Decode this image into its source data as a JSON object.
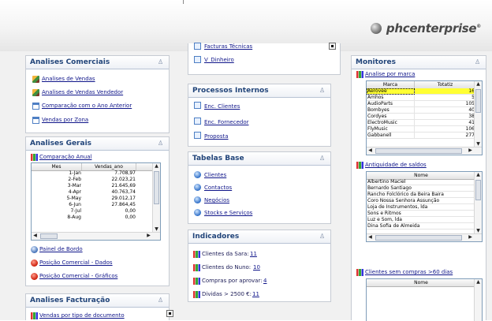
{
  "header": {
    "logo_text": "phcenterprise",
    "logo_mark": "®"
  },
  "col1": {
    "comerciais": {
      "title": "Analises Comerciais",
      "links": [
        "Analises de Vendas",
        "Analises de Vendas Vendedor",
        "Comparação com o Ano Anterior",
        "Vendas por Zona"
      ]
    },
    "gerais": {
      "title": "Analises Gerais",
      "table_link": "Comparação Anual",
      "cols": [
        "Mes",
        "Vendas_ano"
      ],
      "rows": [
        [
          "1-Jan",
          "7.708,97"
        ],
        [
          "2-Feb",
          "22.023,21"
        ],
        [
          "3-Mar",
          "21.645,69"
        ],
        [
          "4-Apr",
          "40.763,74"
        ],
        [
          "5-May",
          "29.012,17"
        ],
        [
          "6-Jun",
          "27.864,45"
        ],
        [
          "7-Jul",
          "0,00"
        ],
        [
          "8-Aug",
          "0,00"
        ]
      ],
      "links": [
        "Painel de Bordo",
        "Posição Comercial - Dados",
        "Posição Comercial - Gráficos"
      ]
    },
    "facturacao": {
      "title": "Analises Facturação",
      "links": [
        "Vendas por tipo de documento"
      ]
    }
  },
  "col2": {
    "top_links": [
      "Facturas Técnicas",
      "V_Dinheiro"
    ],
    "processos": {
      "title": "Processos Internos",
      "links": [
        "Enc. Clientes",
        "Enc. Fornecedor",
        "Proposta"
      ]
    },
    "tabelas": {
      "title": "Tabelas Base",
      "links": [
        "Clientes",
        "Contactos",
        "Negócios",
        "Stocks e Serviços"
      ]
    },
    "indicadores": {
      "title": "Indicadores",
      "items": [
        {
          "label": "Clientes da Sara:",
          "value": "11"
        },
        {
          "label": "Clientes do Nuno:",
          "value": "10"
        },
        {
          "label": "Compras por aprovar:",
          "value": "4"
        },
        {
          "label": "Dividas > 2500 €:",
          "value": "11"
        }
      ]
    }
  },
  "col3": {
    "title": "Monitores",
    "marca": {
      "link": "Analise por marca",
      "cols": [
        "Marca",
        "Totatiz"
      ],
      "rows": [
        [
          "Aerovee",
          "16"
        ],
        [
          "Amhos",
          "5"
        ],
        [
          "AudioParts",
          "105"
        ],
        [
          "Bombyes",
          "40"
        ],
        [
          "Cordyes",
          "38"
        ],
        [
          "ElectroMusic",
          "41"
        ],
        [
          "FlyMusic",
          "106"
        ],
        [
          "Gabbanell",
          "277"
        ]
      ]
    },
    "saldos": {
      "link": "Antiguidade de saldos",
      "cols": [
        "Nome"
      ],
      "rows": [
        "Albertino Maciel",
        "Bernardo Santiago",
        "Rancho Folclórico da Beira Baira",
        "Coro Nossa Senhora Assunção",
        "Loja de Instrumentos, lda",
        "Sons e Ritmos",
        "Luz e Som, lda",
        "Dina Sofia de Almeida"
      ]
    },
    "compras": {
      "link": "Clientes sem compras >60 dias",
      "cols": [
        "Nome"
      ]
    }
  },
  "colors": {
    "title_blue": "#22457a",
    "link_blue": "#10168a",
    "highlight": "#ffff33"
  }
}
